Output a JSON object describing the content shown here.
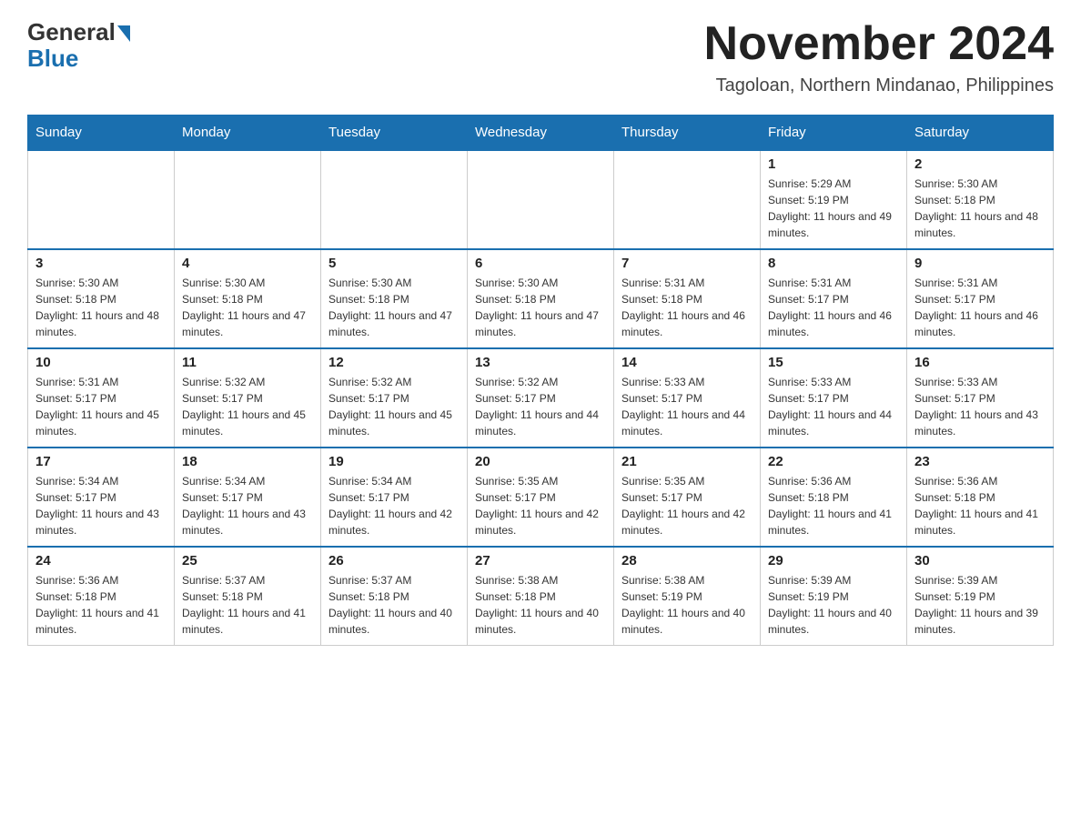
{
  "logo": {
    "general": "General",
    "blue": "Blue"
  },
  "title": "November 2024",
  "subtitle": "Tagoloan, Northern Mindanao, Philippines",
  "days_of_week": [
    "Sunday",
    "Monday",
    "Tuesday",
    "Wednesday",
    "Thursday",
    "Friday",
    "Saturday"
  ],
  "weeks": [
    [
      {
        "day": "",
        "info": ""
      },
      {
        "day": "",
        "info": ""
      },
      {
        "day": "",
        "info": ""
      },
      {
        "day": "",
        "info": ""
      },
      {
        "day": "",
        "info": ""
      },
      {
        "day": "1",
        "info": "Sunrise: 5:29 AM\nSunset: 5:19 PM\nDaylight: 11 hours and 49 minutes."
      },
      {
        "day": "2",
        "info": "Sunrise: 5:30 AM\nSunset: 5:18 PM\nDaylight: 11 hours and 48 minutes."
      }
    ],
    [
      {
        "day": "3",
        "info": "Sunrise: 5:30 AM\nSunset: 5:18 PM\nDaylight: 11 hours and 48 minutes."
      },
      {
        "day": "4",
        "info": "Sunrise: 5:30 AM\nSunset: 5:18 PM\nDaylight: 11 hours and 47 minutes."
      },
      {
        "day": "5",
        "info": "Sunrise: 5:30 AM\nSunset: 5:18 PM\nDaylight: 11 hours and 47 minutes."
      },
      {
        "day": "6",
        "info": "Sunrise: 5:30 AM\nSunset: 5:18 PM\nDaylight: 11 hours and 47 minutes."
      },
      {
        "day": "7",
        "info": "Sunrise: 5:31 AM\nSunset: 5:18 PM\nDaylight: 11 hours and 46 minutes."
      },
      {
        "day": "8",
        "info": "Sunrise: 5:31 AM\nSunset: 5:17 PM\nDaylight: 11 hours and 46 minutes."
      },
      {
        "day": "9",
        "info": "Sunrise: 5:31 AM\nSunset: 5:17 PM\nDaylight: 11 hours and 46 minutes."
      }
    ],
    [
      {
        "day": "10",
        "info": "Sunrise: 5:31 AM\nSunset: 5:17 PM\nDaylight: 11 hours and 45 minutes."
      },
      {
        "day": "11",
        "info": "Sunrise: 5:32 AM\nSunset: 5:17 PM\nDaylight: 11 hours and 45 minutes."
      },
      {
        "day": "12",
        "info": "Sunrise: 5:32 AM\nSunset: 5:17 PM\nDaylight: 11 hours and 45 minutes."
      },
      {
        "day": "13",
        "info": "Sunrise: 5:32 AM\nSunset: 5:17 PM\nDaylight: 11 hours and 44 minutes."
      },
      {
        "day": "14",
        "info": "Sunrise: 5:33 AM\nSunset: 5:17 PM\nDaylight: 11 hours and 44 minutes."
      },
      {
        "day": "15",
        "info": "Sunrise: 5:33 AM\nSunset: 5:17 PM\nDaylight: 11 hours and 44 minutes."
      },
      {
        "day": "16",
        "info": "Sunrise: 5:33 AM\nSunset: 5:17 PM\nDaylight: 11 hours and 43 minutes."
      }
    ],
    [
      {
        "day": "17",
        "info": "Sunrise: 5:34 AM\nSunset: 5:17 PM\nDaylight: 11 hours and 43 minutes."
      },
      {
        "day": "18",
        "info": "Sunrise: 5:34 AM\nSunset: 5:17 PM\nDaylight: 11 hours and 43 minutes."
      },
      {
        "day": "19",
        "info": "Sunrise: 5:34 AM\nSunset: 5:17 PM\nDaylight: 11 hours and 42 minutes."
      },
      {
        "day": "20",
        "info": "Sunrise: 5:35 AM\nSunset: 5:17 PM\nDaylight: 11 hours and 42 minutes."
      },
      {
        "day": "21",
        "info": "Sunrise: 5:35 AM\nSunset: 5:17 PM\nDaylight: 11 hours and 42 minutes."
      },
      {
        "day": "22",
        "info": "Sunrise: 5:36 AM\nSunset: 5:18 PM\nDaylight: 11 hours and 41 minutes."
      },
      {
        "day": "23",
        "info": "Sunrise: 5:36 AM\nSunset: 5:18 PM\nDaylight: 11 hours and 41 minutes."
      }
    ],
    [
      {
        "day": "24",
        "info": "Sunrise: 5:36 AM\nSunset: 5:18 PM\nDaylight: 11 hours and 41 minutes."
      },
      {
        "day": "25",
        "info": "Sunrise: 5:37 AM\nSunset: 5:18 PM\nDaylight: 11 hours and 41 minutes."
      },
      {
        "day": "26",
        "info": "Sunrise: 5:37 AM\nSunset: 5:18 PM\nDaylight: 11 hours and 40 minutes."
      },
      {
        "day": "27",
        "info": "Sunrise: 5:38 AM\nSunset: 5:18 PM\nDaylight: 11 hours and 40 minutes."
      },
      {
        "day": "28",
        "info": "Sunrise: 5:38 AM\nSunset: 5:19 PM\nDaylight: 11 hours and 40 minutes."
      },
      {
        "day": "29",
        "info": "Sunrise: 5:39 AM\nSunset: 5:19 PM\nDaylight: 11 hours and 40 minutes."
      },
      {
        "day": "30",
        "info": "Sunrise: 5:39 AM\nSunset: 5:19 PM\nDaylight: 11 hours and 39 minutes."
      }
    ]
  ]
}
